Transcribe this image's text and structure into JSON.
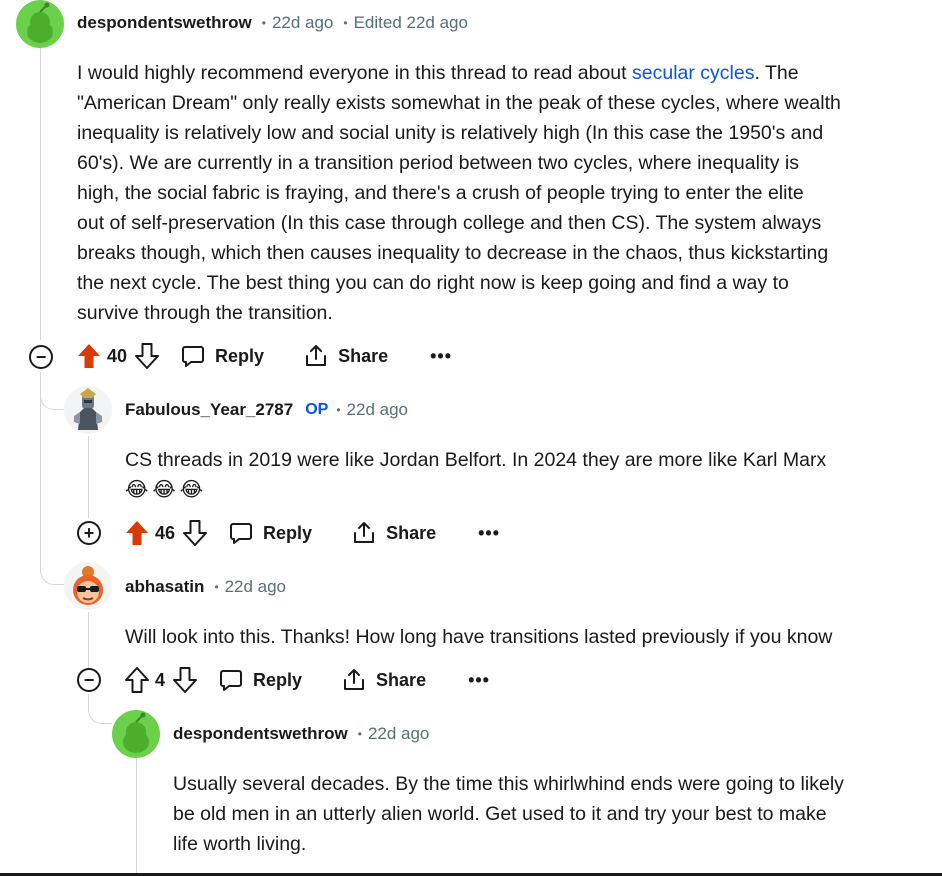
{
  "comments": [
    {
      "username": "despondentswethrow",
      "time": "22d ago",
      "edited": "Edited 22d ago",
      "body": {
        "pre": "I would highly recommend everyone in this thread to read about ",
        "link": "secular cycles",
        "post": ". The",
        "lines": [
          "\"American Dream\" only really exists somewhat in the peak of these cycles, where wealth",
          "inequality is relatively low and social unity is relatively high (In this case the 1950's and",
          "60's). We are currently in a transition period between two cycles, where inequality is",
          "high, the social fabric is fraying, and there's a crush of people trying to enter the elite",
          "out of self-preservation (In this case through college and then CS). The system always",
          "breaks though, which then causes inequality to decrease in the chaos, thus kickstarting",
          "the next cycle. The best thing you can do right now is keep going and find a way to",
          "survive through the transition."
        ]
      },
      "votes": "40",
      "collapse": "−",
      "reply": "Reply",
      "share": "Share",
      "more": "•••"
    },
    {
      "username": "Fabulous_Year_2787",
      "op": "OP",
      "time": "22d ago",
      "body": "CS threads in 2019 were like Jordan Belfort. In 2024 they are more like Karl Marx",
      "emojis": "😂😂😂",
      "votes": "46",
      "collapse": "+",
      "reply": "Reply",
      "share": "Share",
      "more": "•••"
    },
    {
      "username": "abhasatin",
      "time": "22d ago",
      "body": "Will look into this. Thanks! How long have transitions lasted previously if you know",
      "votes": "4",
      "collapse": "−",
      "reply": "Reply",
      "share": "Share",
      "more": "•••"
    },
    {
      "username": "despondentswethrow",
      "time": "22d ago",
      "lines": [
        "Usually several decades. By the time this whirlwhind ends were going to likely",
        "be old men in an utterly alien world. Get used to it and try your best to make",
        "life worth living."
      ]
    }
  ],
  "colors": {
    "upvoted": "#d93a00",
    "link": "#0a55d9",
    "op": "#0a55d9",
    "meta": "#576f76",
    "thread_line": "#d4d7d9",
    "avatar_green": "#6bd04a"
  },
  "icons": [
    "snoo-avatar-icon",
    "upvote-icon",
    "downvote-icon",
    "comment-icon",
    "share-icon",
    "collapse-icon",
    "expand-icon",
    "more-icon"
  ]
}
